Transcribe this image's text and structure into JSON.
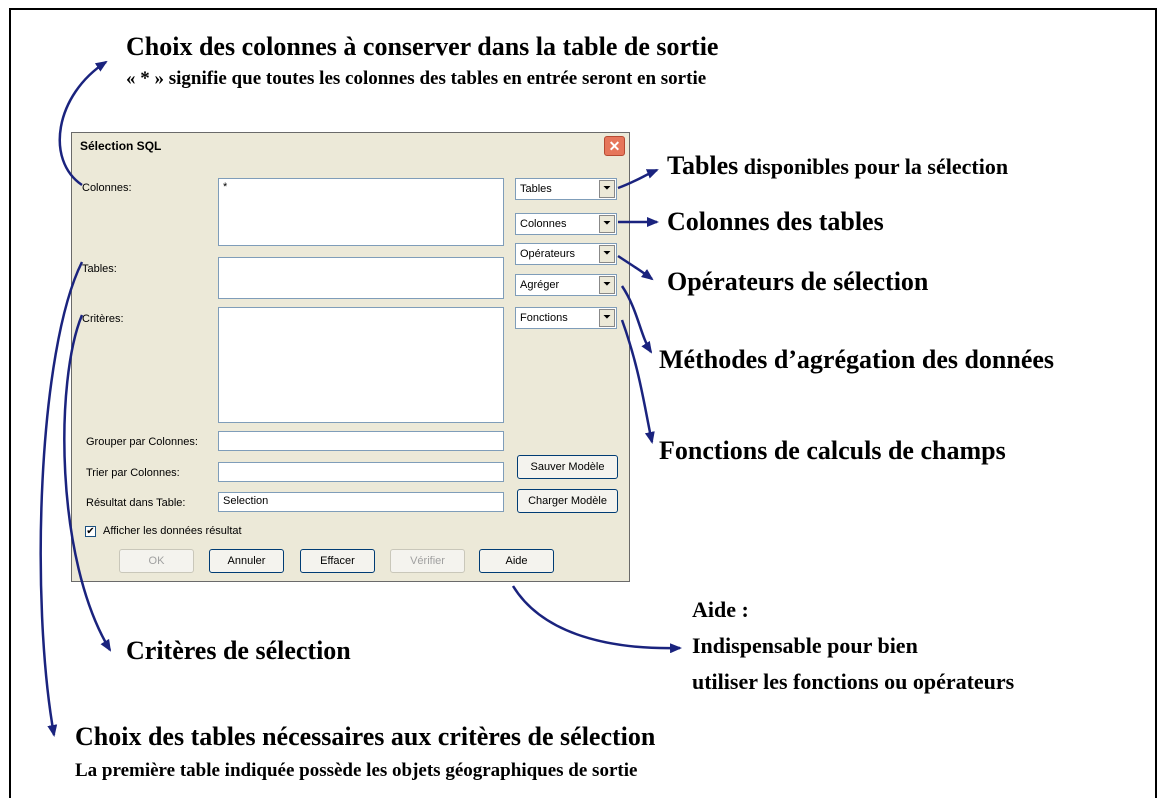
{
  "annotations": {
    "colonnes_title": "Choix des colonnes à conserver dans la table de sortie",
    "colonnes_note": "« * » signifie que toutes les colonnes des tables en entrée seront en sortie",
    "tables_bold": "Tables",
    "tables_rest": " disponibles pour la sélection",
    "colonnes_tables": "Colonnes des tables",
    "operateurs": "Opérateurs de sélection",
    "agregation": "Méthodes d’agrégation des données",
    "fonctions": "Fonctions de calculs de champs",
    "aide_title": "Aide :",
    "aide_line1": "Indispensable pour bien",
    "aide_line2": "utiliser les fonctions ou opérateurs",
    "criteres": "Critères de sélection",
    "tables_choice_title": "Choix des tables nécessaires aux critères de sélection",
    "tables_choice_note": "La première table indiquée possède les objets géographiques de sortie"
  },
  "dialog": {
    "title": "Sélection SQL",
    "close_glyph": "✕",
    "labels": {
      "colonnes": "Colonnes:",
      "tables": "Tables:",
      "criteres": "Critères:",
      "grouper": "Grouper par Colonnes:",
      "trier": "Trier par Colonnes:",
      "resultat": "Résultat dans Table:"
    },
    "values": {
      "colonnes": "*",
      "tables": "",
      "criteres": "",
      "grouper": "",
      "trier": "",
      "resultat": "Selection"
    },
    "combos": [
      "Tables",
      "Colonnes",
      "Opérateurs",
      "Agréger",
      "Fonctions"
    ],
    "buttons": {
      "sauver": "Sauver Modèle",
      "charger": "Charger Modèle",
      "ok": "OK",
      "annuler": "Annuler",
      "effacer": "Effacer",
      "verifier": "Vérifier",
      "aide": "Aide"
    },
    "checkbox_label": "Afficher les données résultat",
    "checkbox_checked": true
  },
  "colors": {
    "arrow": "#1a237e",
    "close": "#e6765b"
  }
}
